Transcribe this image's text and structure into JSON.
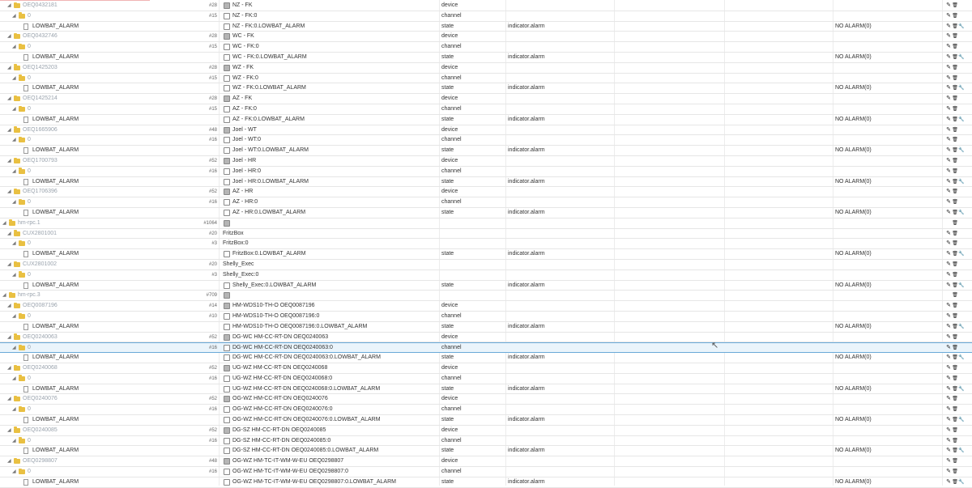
{
  "rows": [
    {
      "kind": "device",
      "indent": 1,
      "label": "OEQ0432181",
      "num": "#28",
      "name": "NZ - FK",
      "icon": "device-icon",
      "type": "device",
      "role": "",
      "value": "",
      "actions": "two"
    },
    {
      "kind": "channel",
      "indent": 2,
      "label": "0",
      "num": "#15",
      "name": "NZ - FK:0",
      "icon": "channel-icon",
      "type": "channel",
      "role": "",
      "value": "",
      "actions": "two"
    },
    {
      "kind": "state",
      "indent": 3,
      "label": "LOWBAT_ALARM",
      "num": "",
      "name": "NZ - FK:0.LOWBAT_ALARM",
      "icon": "file-icon",
      "type": "state",
      "role": "indicator.alarm",
      "value": "NO ALARM(0)",
      "actions": "three"
    },
    {
      "kind": "device",
      "indent": 1,
      "label": "OEQ0432746",
      "num": "#28",
      "name": "WC - FK",
      "icon": "device-icon",
      "type": "device",
      "role": "",
      "value": "",
      "actions": "two"
    },
    {
      "kind": "channel",
      "indent": 2,
      "label": "0",
      "num": "#15",
      "name": "WC - FK:0",
      "icon": "channel-icon",
      "type": "channel",
      "role": "",
      "value": "",
      "actions": "two"
    },
    {
      "kind": "state",
      "indent": 3,
      "label": "LOWBAT_ALARM",
      "num": "",
      "name": "WC - FK:0.LOWBAT_ALARM",
      "icon": "file-icon",
      "type": "state",
      "role": "indicator.alarm",
      "value": "NO ALARM(0)",
      "actions": "three"
    },
    {
      "kind": "device",
      "indent": 1,
      "label": "OEQ1425203",
      "num": "#28",
      "name": "WZ - FK",
      "icon": "device-icon",
      "type": "device",
      "role": "",
      "value": "",
      "actions": "two"
    },
    {
      "kind": "channel",
      "indent": 2,
      "label": "0",
      "num": "#15",
      "name": "WZ - FK:0",
      "icon": "channel-icon",
      "type": "channel",
      "role": "",
      "value": "",
      "actions": "two"
    },
    {
      "kind": "state",
      "indent": 3,
      "label": "LOWBAT_ALARM",
      "num": "",
      "name": "WZ - FK:0.LOWBAT_ALARM",
      "icon": "file-icon",
      "type": "state",
      "role": "indicator.alarm",
      "value": "NO ALARM(0)",
      "actions": "three"
    },
    {
      "kind": "device",
      "indent": 1,
      "label": "OEQ1425214",
      "num": "#28",
      "name": "AZ - FK",
      "icon": "device-icon",
      "type": "device",
      "role": "",
      "value": "",
      "actions": "two"
    },
    {
      "kind": "channel",
      "indent": 2,
      "label": "0",
      "num": "#15",
      "name": "AZ - FK:0",
      "icon": "channel-icon",
      "type": "channel",
      "role": "",
      "value": "",
      "actions": "two"
    },
    {
      "kind": "state",
      "indent": 3,
      "label": "LOWBAT_ALARM",
      "num": "",
      "name": "AZ - FK:0.LOWBAT_ALARM",
      "icon": "file-icon",
      "type": "state",
      "role": "indicator.alarm",
      "value": "NO ALARM(0)",
      "actions": "three"
    },
    {
      "kind": "device",
      "indent": 1,
      "label": "OEQ1665906",
      "num": "#48",
      "name": "Joel - WT",
      "icon": "device-icon",
      "type": "device",
      "role": "",
      "value": "",
      "actions": "two"
    },
    {
      "kind": "channel",
      "indent": 2,
      "label": "0",
      "num": "#16",
      "name": "Joel - WT:0",
      "icon": "channel-icon",
      "type": "channel",
      "role": "",
      "value": "",
      "actions": "two"
    },
    {
      "kind": "state",
      "indent": 3,
      "label": "LOWBAT_ALARM",
      "num": "",
      "name": "Joel - WT:0.LOWBAT_ALARM",
      "icon": "file-icon",
      "type": "state",
      "role": "indicator.alarm",
      "value": "NO ALARM(0)",
      "actions": "three"
    },
    {
      "kind": "device",
      "indent": 1,
      "label": "OEQ1700793",
      "num": "#52",
      "name": "Joel - HR",
      "icon": "device-icon",
      "type": "device",
      "role": "",
      "value": "",
      "actions": "two"
    },
    {
      "kind": "channel",
      "indent": 2,
      "label": "0",
      "num": "#16",
      "name": "Joel - HR:0",
      "icon": "channel-icon",
      "type": "channel",
      "role": "",
      "value": "",
      "actions": "two"
    },
    {
      "kind": "state",
      "indent": 3,
      "label": "LOWBAT_ALARM",
      "num": "",
      "name": "Joel - HR:0.LOWBAT_ALARM",
      "icon": "file-icon",
      "type": "state",
      "role": "indicator.alarm",
      "value": "NO ALARM(0)",
      "actions": "three"
    },
    {
      "kind": "device",
      "indent": 1,
      "label": "OEQ1706396",
      "num": "#52",
      "name": "AZ - HR",
      "icon": "device-icon",
      "type": "device",
      "role": "",
      "value": "",
      "actions": "two"
    },
    {
      "kind": "channel",
      "indent": 2,
      "label": "0",
      "num": "#16",
      "name": "AZ - HR:0",
      "icon": "channel-icon",
      "type": "channel",
      "role": "",
      "value": "",
      "actions": "two"
    },
    {
      "kind": "state",
      "indent": 3,
      "label": "LOWBAT_ALARM",
      "num": "",
      "name": "AZ - HR:0.LOWBAT_ALARM",
      "icon": "file-icon",
      "type": "state",
      "role": "indicator.alarm",
      "value": "NO ALARM(0)",
      "actions": "three"
    },
    {
      "kind": "adapter",
      "indent": 0,
      "label": "hm-rpc.1",
      "num": "#1064",
      "name": "",
      "icon": "instance-icon",
      "type": "",
      "role": "",
      "value": "",
      "actions": "one"
    },
    {
      "kind": "device",
      "indent": 1,
      "label": "CUX2801001",
      "num": "#20",
      "name": "FritzBox",
      "icon": "",
      "type": "",
      "role": "",
      "value": "",
      "actions": "two"
    },
    {
      "kind": "channel",
      "indent": 2,
      "label": "0",
      "num": "#3",
      "name": "FritzBox:0",
      "icon": "",
      "type": "",
      "role": "",
      "value": "",
      "actions": "two"
    },
    {
      "kind": "state",
      "indent": 3,
      "label": "LOWBAT_ALARM",
      "num": "",
      "name": "FritzBox:0.LOWBAT_ALARM",
      "icon": "file-icon",
      "type": "state",
      "role": "indicator.alarm",
      "value": "NO ALARM(0)",
      "actions": "three"
    },
    {
      "kind": "device",
      "indent": 1,
      "label": "CUX2801002",
      "num": "#20",
      "name": "Shelly_Exec",
      "icon": "",
      "type": "",
      "role": "",
      "value": "",
      "actions": "two"
    },
    {
      "kind": "channel",
      "indent": 2,
      "label": "0",
      "num": "#3",
      "name": "Shelly_Exec:0",
      "icon": "",
      "type": "",
      "role": "",
      "value": "",
      "actions": "two"
    },
    {
      "kind": "state",
      "indent": 3,
      "label": "LOWBAT_ALARM",
      "num": "",
      "name": "Shelly_Exec:0.LOWBAT_ALARM",
      "icon": "file-icon",
      "type": "state",
      "role": "indicator.alarm",
      "value": "NO ALARM(0)",
      "actions": "three"
    },
    {
      "kind": "adapter",
      "indent": 0,
      "label": "hm-rpc.3",
      "num": "#709",
      "name": "",
      "icon": "instance-icon",
      "type": "",
      "role": "",
      "value": "",
      "actions": "one"
    },
    {
      "kind": "device",
      "indent": 1,
      "label": "OEQ0087196",
      "num": "#14",
      "name": "HM-WDS10-TH-O OEQ0087196",
      "icon": "device-icon",
      "type": "device",
      "role": "",
      "value": "",
      "actions": "two"
    },
    {
      "kind": "channel",
      "indent": 2,
      "label": "0",
      "num": "#10",
      "name": "HM-WDS10-TH-O OEQ0087196:0",
      "icon": "channel-icon",
      "type": "channel",
      "role": "",
      "value": "",
      "actions": "two"
    },
    {
      "kind": "state",
      "indent": 3,
      "label": "LOWBAT_ALARM",
      "num": "",
      "name": "HM-WDS10-TH-O OEQ0087196:0.LOWBAT_ALARM",
      "icon": "file-icon",
      "type": "state",
      "role": "indicator.alarm",
      "value": "NO ALARM(0)",
      "actions": "three"
    },
    {
      "kind": "device",
      "indent": 1,
      "label": "OEQ0240063",
      "num": "#52",
      "name": "DG-WC HM-CC-RT-DN OEQ0240063",
      "icon": "device-icon",
      "type": "device",
      "role": "",
      "value": "",
      "actions": "two"
    },
    {
      "kind": "channel",
      "indent": 2,
      "label": "0",
      "num": "#16",
      "name": "DG-WC HM-CC-RT-DN OEQ0240063:0",
      "icon": "channel-icon",
      "type": "channel",
      "role": "",
      "value": "",
      "actions": "two",
      "selected": true
    },
    {
      "kind": "state",
      "indent": 3,
      "label": "LOWBAT_ALARM",
      "num": "",
      "name": "DG-WC HM-CC-RT-DN OEQ0240063:0.LOWBAT_ALARM",
      "icon": "file-icon",
      "type": "state",
      "role": "indicator.alarm",
      "value": "NO ALARM(0)",
      "actions": "three"
    },
    {
      "kind": "device",
      "indent": 1,
      "label": "OEQ0240068",
      "num": "#52",
      "name": "UG-WZ HM-CC-RT-DN OEQ0240068",
      "icon": "device-icon",
      "type": "device",
      "role": "",
      "value": "",
      "actions": "two"
    },
    {
      "kind": "channel",
      "indent": 2,
      "label": "0",
      "num": "#16",
      "name": "UG-WZ HM-CC-RT-DN OEQ0240068:0",
      "icon": "channel-icon",
      "type": "channel",
      "role": "",
      "value": "",
      "actions": "two"
    },
    {
      "kind": "state",
      "indent": 3,
      "label": "LOWBAT_ALARM",
      "num": "",
      "name": "UG-WZ HM-CC-RT-DN OEQ0240068:0.LOWBAT_ALARM",
      "icon": "file-icon",
      "type": "state",
      "role": "indicator.alarm",
      "value": "NO ALARM(0)",
      "actions": "three"
    },
    {
      "kind": "device",
      "indent": 1,
      "label": "OEQ0240076",
      "num": "#52",
      "name": "OG-WZ HM-CC-RT-DN OEQ0240076",
      "icon": "device-icon",
      "type": "device",
      "role": "",
      "value": "",
      "actions": "two"
    },
    {
      "kind": "channel",
      "indent": 2,
      "label": "0",
      "num": "#16",
      "name": "OG-WZ HM-CC-RT-DN OEQ0240076:0",
      "icon": "channel-icon",
      "type": "channel",
      "role": "",
      "value": "",
      "actions": "two"
    },
    {
      "kind": "state",
      "indent": 3,
      "label": "LOWBAT_ALARM",
      "num": "",
      "name": "OG-WZ HM-CC-RT-DN OEQ0240076:0.LOWBAT_ALARM",
      "icon": "file-icon",
      "type": "state",
      "role": "indicator.alarm",
      "value": "NO ALARM(0)",
      "actions": "three"
    },
    {
      "kind": "device",
      "indent": 1,
      "label": "OEQ0240085",
      "num": "#52",
      "name": "DG-SZ HM-CC-RT-DN OEQ0240085",
      "icon": "device-icon",
      "type": "device",
      "role": "",
      "value": "",
      "actions": "two"
    },
    {
      "kind": "channel",
      "indent": 2,
      "label": "0",
      "num": "#16",
      "name": "DG-SZ HM-CC-RT-DN OEQ0240085:0",
      "icon": "channel-icon",
      "type": "channel",
      "role": "",
      "value": "",
      "actions": "two"
    },
    {
      "kind": "state",
      "indent": 3,
      "label": "LOWBAT_ALARM",
      "num": "",
      "name": "DG-SZ HM-CC-RT-DN OEQ0240085:0.LOWBAT_ALARM",
      "icon": "file-icon",
      "type": "state",
      "role": "indicator.alarm",
      "value": "NO ALARM(0)",
      "actions": "three"
    },
    {
      "kind": "device",
      "indent": 1,
      "label": "OEQ0298807",
      "num": "#48",
      "name": "OG-WZ HM-TC-IT-WM-W-EU OEQ0298807",
      "icon": "device-icon",
      "type": "device",
      "role": "",
      "value": "",
      "actions": "two"
    },
    {
      "kind": "channel",
      "indent": 2,
      "label": "0",
      "num": "#16",
      "name": "OG-WZ HM-TC-IT-WM-W-EU OEQ0298807:0",
      "icon": "channel-icon",
      "type": "channel",
      "role": "",
      "value": "",
      "actions": "two"
    },
    {
      "kind": "state",
      "indent": 3,
      "label": "LOWBAT_ALARM",
      "num": "",
      "name": "OG-WZ HM-TC-IT-WM-W-EU OEQ0298807:0.LOWBAT_ALARM",
      "icon": "file-icon",
      "type": "state",
      "role": "indicator.alarm",
      "value": "NO ALARM(0)",
      "actions": "three"
    }
  ],
  "icons": {
    "edit": "✎",
    "delete": "🗑",
    "wrench": "🔧",
    "cursor": "↖"
  },
  "colors": {
    "folder": "#e9c042",
    "selected_bg": "#eaf4fb",
    "selected_border": "#6aa9d8",
    "grey_label": "#9aa3ad"
  }
}
